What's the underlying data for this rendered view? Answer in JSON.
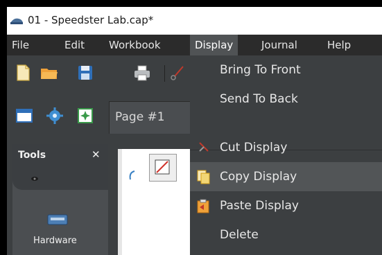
{
  "window": {
    "title": "01 - Speedster Lab.cap*"
  },
  "menubar": {
    "items": [
      {
        "label": "File"
      },
      {
        "label": "Edit"
      },
      {
        "label": "Workbook"
      },
      {
        "label": "Display"
      },
      {
        "label": "Journal"
      },
      {
        "label": "Help"
      }
    ],
    "active": "Display"
  },
  "page_tab": {
    "label": "Page #1"
  },
  "tools_panel": {
    "title": "Tools",
    "close_glyph": "✕",
    "hardware_label": "Hardware"
  },
  "display_menu": {
    "items": [
      {
        "label": "Bring To Front",
        "icon": "none"
      },
      {
        "label": "Send To Back",
        "icon": "none"
      },
      {
        "label": "Cut Display",
        "icon": "scissors-icon"
      },
      {
        "label": "Copy Display",
        "icon": "copy-icon",
        "highlighted": true
      },
      {
        "label": "Paste Display",
        "icon": "paste-icon"
      },
      {
        "label": "Delete",
        "icon": "none"
      }
    ]
  },
  "colors": {
    "menubar_bg": "#2b2b2b",
    "panel_bg": "#3c3f41",
    "menu_highlight": "#525557",
    "folder_orange": "#f0a23a",
    "save_blue": "#2f6fb8"
  }
}
